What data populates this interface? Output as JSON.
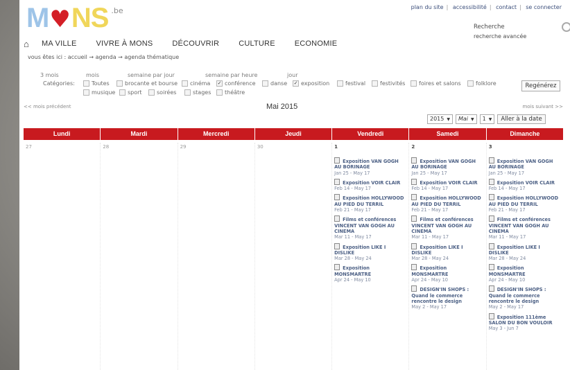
{
  "site": {
    "logo_a": "M",
    "logo_b": "NS",
    "logo_suffix": ".be",
    "logo_color_m": "#9ec4e8",
    "logo_color_ns": "#f0d65a",
    "heart_color": "#d41f27"
  },
  "toplinks": [
    "plan du site",
    "accessibilité",
    "contact",
    "se connecter"
  ],
  "search": {
    "label": "Recherche",
    "advanced": "recherche avancée"
  },
  "nav": {
    "home_icon": "home-icon",
    "items": [
      "MA VILLE",
      "VIVRE À MONS",
      "DÉCOUVRIR",
      "CULTURE",
      "ECONOMIE"
    ]
  },
  "breadcrumb": "vous êtes ici : accueil → agenda → agenda thématique",
  "views": [
    "3 mois",
    "mois",
    "semaine par jour",
    "semaine par heure",
    "jour"
  ],
  "categories": {
    "label": "Catégories:",
    "items": [
      {
        "label": "Toutes",
        "checked": false
      },
      {
        "label": "brocante et bourse",
        "checked": false
      },
      {
        "label": "cinéma",
        "checked": false
      },
      {
        "label": "conférence",
        "checked": true
      },
      {
        "label": "danse",
        "checked": false
      },
      {
        "label": "exposition",
        "checked": true
      },
      {
        "label": "festival",
        "checked": false
      },
      {
        "label": "festivités",
        "checked": false
      },
      {
        "label": "foires et salons",
        "checked": false
      },
      {
        "label": "folklore",
        "checked": false
      },
      {
        "label": "musique",
        "checked": false
      },
      {
        "label": "sport",
        "checked": false
      },
      {
        "label": "soirées",
        "checked": false
      },
      {
        "label": "stages",
        "checked": false
      },
      {
        "label": "théâtre",
        "checked": false
      }
    ],
    "button": "Regénérez"
  },
  "month": {
    "prev": "<< mois précédent",
    "next": "mois suivant >>",
    "title": "Mai 2015"
  },
  "selectors": {
    "year": "2015",
    "month": "Mai",
    "day": "1",
    "goto": "Aller à la date"
  },
  "calendar": {
    "header_color": "#c81a1f",
    "weekdays": [
      "Lundi",
      "Mardi",
      "Mercredi",
      "Jeudi",
      "Vendredi",
      "Samedi",
      "Dimanche"
    ],
    "days": [
      {
        "num": "27",
        "events": []
      },
      {
        "num": "28",
        "events": []
      },
      {
        "num": "29",
        "events": []
      },
      {
        "num": "30",
        "events": []
      },
      {
        "num": "1",
        "events": [
          {
            "title": "Exposition VAN GOGH AU BORINAGE",
            "dates": "Jan 25 - May 17"
          },
          {
            "title": "Exposition VOIR CLAIR",
            "dates": "Feb 14 - May 17"
          },
          {
            "title": "Exposition HOLLYWOOD AU PIED DU TERRIL",
            "dates": "Feb 21 - May 17"
          },
          {
            "title": "Films et conférences VINCENT VAN GOGH AU CINEMA",
            "dates": "Mar 11 - May 17"
          },
          {
            "title": "Exposition LIKE I DISLIKE",
            "dates": "Mar 28 - May 24"
          },
          {
            "title": "Exposition MONSMARTRE",
            "dates": "Apr 24 - May 10"
          }
        ]
      },
      {
        "num": "2",
        "events": [
          {
            "title": "Exposition VAN GOGH AU BORINAGE",
            "dates": "Jan 25 - May 17"
          },
          {
            "title": "Exposition VOIR CLAIR",
            "dates": "Feb 14 - May 17"
          },
          {
            "title": "Exposition HOLLYWOOD AU PIED DU TERRIL",
            "dates": "Feb 21 - May 17"
          },
          {
            "title": "Films et conférences VINCENT VAN GOGH AU CINEMA",
            "dates": "Mar 11 - May 17"
          },
          {
            "title": "Exposition LIKE I DISLIKE",
            "dates": "Mar 28 - May 24"
          },
          {
            "title": "Exposition MONSMARTRE",
            "dates": "Apr 24 - May 10"
          },
          {
            "title": "DESIGN'IN SHOPS : Quand le commerce rencontre le design",
            "dates": "May 2 - May 17"
          }
        ]
      },
      {
        "num": "3",
        "events": [
          {
            "title": "Exposition VAN GOGH AU BORINAGE",
            "dates": "Jan 25 - May 17"
          },
          {
            "title": "Exposition VOIR CLAIR",
            "dates": "Feb 14 - May 17"
          },
          {
            "title": "Exposition HOLLYWOOD AU PIED DU TERRIL",
            "dates": "Feb 21 - May 17"
          },
          {
            "title": "Films et conférences VINCENT VAN GOGH AU CINEMA",
            "dates": "Mar 11 - May 17"
          },
          {
            "title": "Exposition LIKE I DISLIKE",
            "dates": "Mar 28 - May 24"
          },
          {
            "title": "Exposition MONSMARTRE",
            "dates": "Apr 24 - May 10"
          },
          {
            "title": "DESIGN'IN SHOPS : Quand le commerce rencontre le design",
            "dates": "May 2 - May 17"
          },
          {
            "title": "Exposition 111ème SALON DU BON VOULOIR",
            "dates": "May 3 - Jun 7"
          }
        ]
      }
    ]
  }
}
